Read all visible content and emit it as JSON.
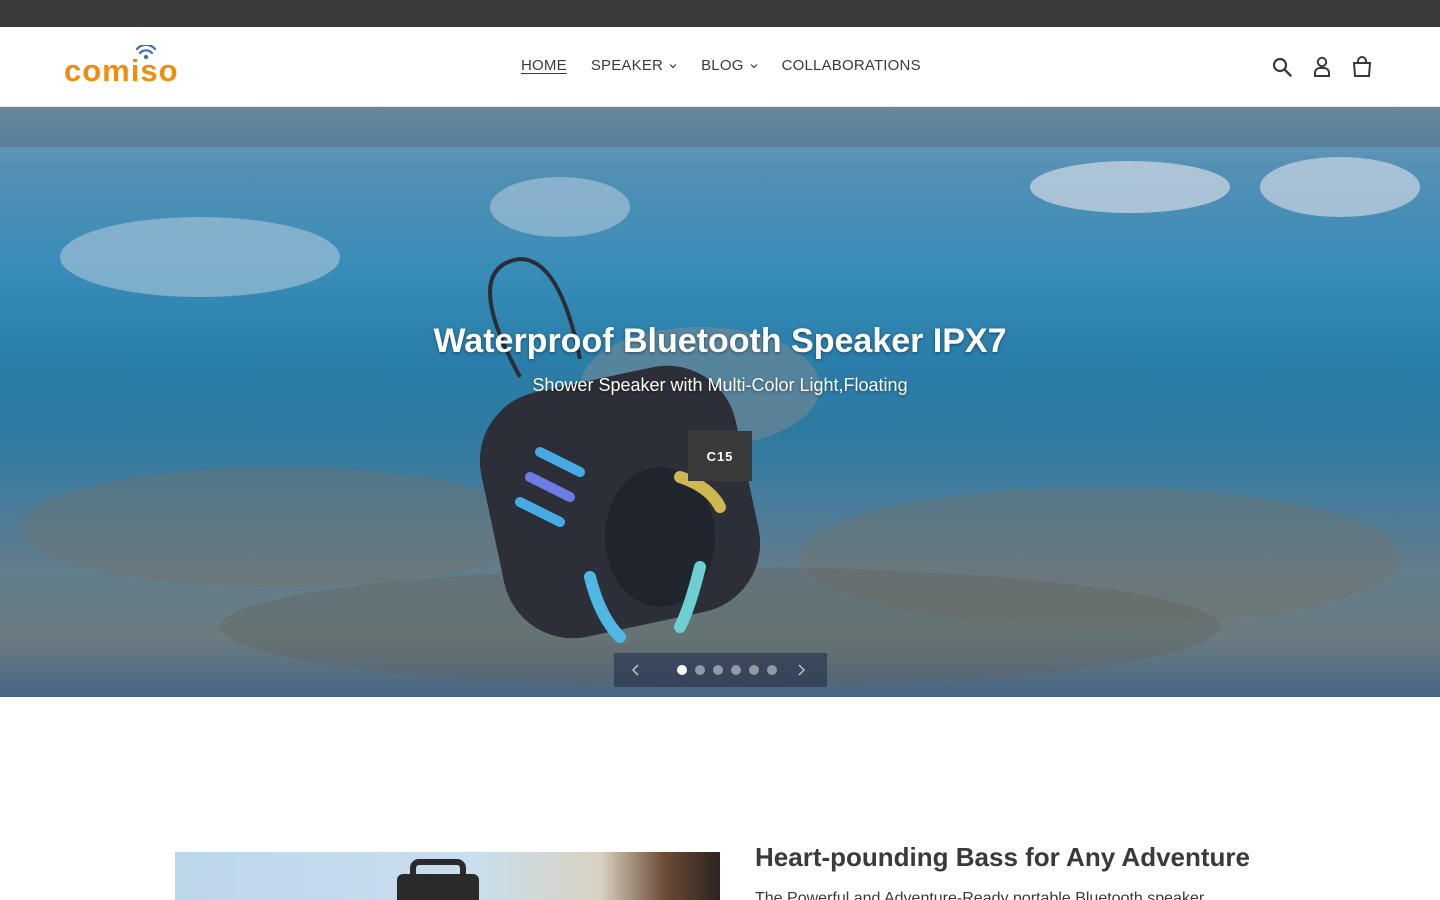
{
  "brand": {
    "logo_text": "comiso",
    "accent_color": "#f28c0f",
    "signal_color": "#3a6fb7"
  },
  "nav": {
    "items": [
      {
        "label": "HOME",
        "active": true,
        "has_dropdown": false
      },
      {
        "label": "SPEAKER",
        "active": false,
        "has_dropdown": true
      },
      {
        "label": "BLOG",
        "active": false,
        "has_dropdown": true
      },
      {
        "label": "COLLABORATIONS",
        "active": false,
        "has_dropdown": false
      }
    ]
  },
  "header_icons": [
    "search-icon",
    "account-icon",
    "cart-icon"
  ],
  "hero": {
    "title": "Waterproof Bluetooth Speaker IPX7",
    "subtitle": "Shower Speaker with Multi-Color Light,Floating",
    "button_label": "C15",
    "slides": 6,
    "active_slide": 1
  },
  "feature": {
    "heading": "Heart-pounding Bass for Any Adventure",
    "text": "The Powerful and Adventure-Ready portable Bluetooth speaker"
  }
}
